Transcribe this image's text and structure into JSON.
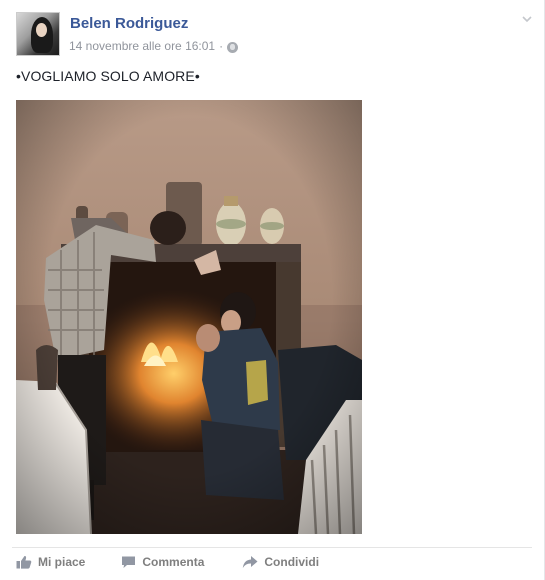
{
  "post": {
    "author": "Belen Rodriguez",
    "timestamp": "14 novembre alle ore 16:01",
    "separator": "·",
    "privacy_icon": "globe-icon",
    "text": "•VOGLIAMO SOLO AMORE•",
    "options_icon": "chevron-down-icon"
  },
  "actions": {
    "like_label": "Mi piace",
    "like_icon": "thumbs-up-icon",
    "comment_label": "Commenta",
    "comment_icon": "speech-bubble-icon",
    "share_label": "Condividi",
    "share_icon": "share-arrow-icon"
  },
  "colors": {
    "author_link": "#3b5998",
    "meta_text": "#90949c",
    "action_text": "#7f7f7f",
    "body_text": "#1d2129"
  }
}
